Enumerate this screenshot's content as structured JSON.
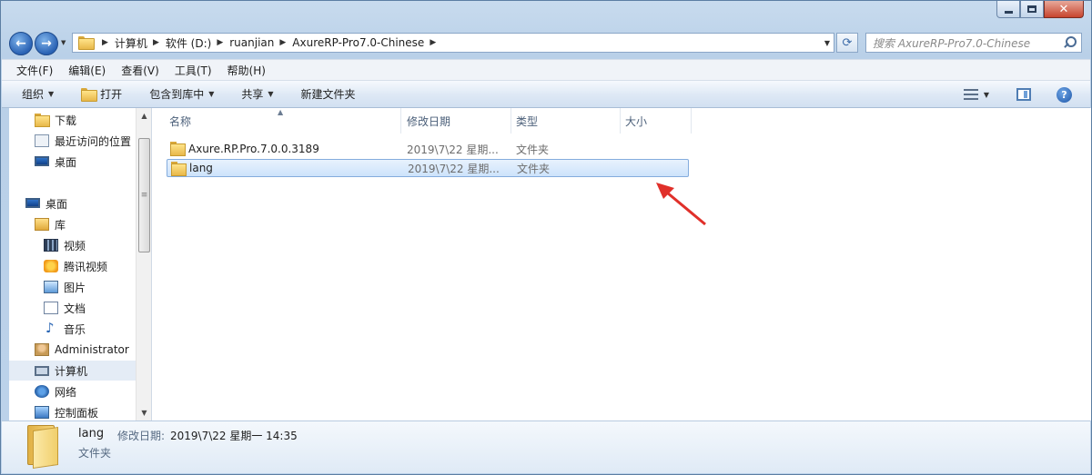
{
  "window": {
    "caption": {
      "minimize": "minimize",
      "maximize": "maximize",
      "close": "close"
    }
  },
  "address_bar": {
    "breadcrumbs": [
      "计算机",
      "软件 (D:)",
      "ruanjian",
      "AxureRP-Pro7.0-Chinese"
    ],
    "search_placeholder": "搜索 AxureRP-Pro7.0-Chinese"
  },
  "menubar": {
    "items": [
      "文件(F)",
      "编辑(E)",
      "查看(V)",
      "工具(T)",
      "帮助(H)"
    ]
  },
  "commandbar": {
    "organize": "组织",
    "open": "打开",
    "include_in_library": "包含到库中",
    "share": "共享",
    "new_folder": "新建文件夹"
  },
  "navpane": {
    "items": [
      {
        "label": "下载",
        "icon": "download-folder-icon"
      },
      {
        "label": "最近访问的位置",
        "icon": "recent-places-icon"
      },
      {
        "label": "桌面",
        "icon": "desktop-icon"
      },
      {
        "label": "桌面",
        "icon": "desktop-icon"
      },
      {
        "label": "库",
        "icon": "library-icon"
      },
      {
        "label": "视频",
        "icon": "video-icon"
      },
      {
        "label": "腾讯视频",
        "icon": "tencent-video-icon"
      },
      {
        "label": "图片",
        "icon": "pictures-icon"
      },
      {
        "label": "文档",
        "icon": "documents-icon"
      },
      {
        "label": "音乐",
        "icon": "music-icon"
      },
      {
        "label": "Administrator",
        "icon": "user-folder-icon"
      },
      {
        "label": "计算机",
        "icon": "computer-icon"
      },
      {
        "label": "网络",
        "icon": "network-icon"
      },
      {
        "label": "控制面板",
        "icon": "control-panel-icon"
      }
    ]
  },
  "filelist": {
    "columns": [
      "名称",
      "修改日期",
      "类型",
      "大小"
    ],
    "rows": [
      {
        "name": "Axure.RP.Pro.7.0.0.3189",
        "date": "2019\\7\\22 星期...",
        "type": "文件夹",
        "size": ""
      },
      {
        "name": "lang",
        "date": "2019\\7\\22 星期...",
        "type": "文件夹",
        "size": ""
      }
    ],
    "selected_index": 1
  },
  "details": {
    "name": "lang",
    "date_label": "修改日期:",
    "date_value": "2019\\7\\22 星期一 14:35",
    "type": "文件夹"
  },
  "colors": {
    "selection_border": "#84acdd",
    "annotation_arrow": "#e0302a"
  }
}
